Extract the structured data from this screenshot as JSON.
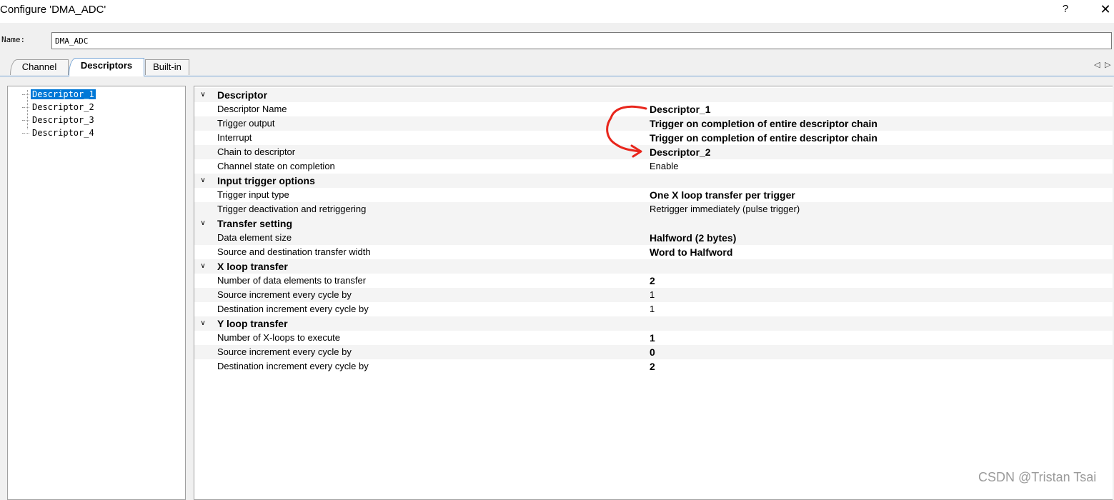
{
  "window": {
    "title": "Configure 'DMA_ADC'",
    "help_glyph": "?",
    "close_glyph": "✕"
  },
  "name_field": {
    "label": "Name:",
    "value": "DMA_ADC"
  },
  "tabs": [
    {
      "label": "Channel",
      "active": false
    },
    {
      "label": "Descriptors",
      "active": true
    },
    {
      "label": "Built-in",
      "active": false
    }
  ],
  "tab_scroll": {
    "left": "◁",
    "right": "▷"
  },
  "tree": {
    "items": [
      {
        "label": "Descriptor_1",
        "selected": true
      },
      {
        "label": "Descriptor_2",
        "selected": false
      },
      {
        "label": "Descriptor_3",
        "selected": false
      },
      {
        "label": "Descriptor_4",
        "selected": false
      }
    ]
  },
  "chevron_glyph": "∨",
  "properties": [
    {
      "type": "category",
      "label": "Descriptor"
    },
    {
      "type": "prop",
      "name": "Descriptor Name",
      "value": "Descriptor_1",
      "bold": true
    },
    {
      "type": "prop",
      "name": "Trigger output",
      "value": "Trigger on completion of entire descriptor chain",
      "bold": true
    },
    {
      "type": "prop",
      "name": "Interrupt",
      "value": "Trigger on completion of entire descriptor chain",
      "bold": true
    },
    {
      "type": "prop",
      "name": "Chain to descriptor",
      "value": "Descriptor_2",
      "bold": true
    },
    {
      "type": "prop",
      "name": "Channel state on completion",
      "value": "Enable",
      "bold": false
    },
    {
      "type": "category",
      "label": "Input trigger options"
    },
    {
      "type": "prop",
      "name": "Trigger input type",
      "value": "One X loop transfer per trigger",
      "bold": true
    },
    {
      "type": "prop",
      "name": "Trigger deactivation and retriggering",
      "value": "Retrigger immediately (pulse trigger)",
      "bold": false
    },
    {
      "type": "category",
      "label": "Transfer setting"
    },
    {
      "type": "prop",
      "name": "Data element size",
      "value": "Halfword (2 bytes)",
      "bold": true
    },
    {
      "type": "prop",
      "name": "Source and destination transfer width",
      "value": "Word to Halfword",
      "bold": true
    },
    {
      "type": "category",
      "label": "X loop transfer"
    },
    {
      "type": "prop",
      "name": "Number of data elements to transfer",
      "value": "2",
      "bold": true
    },
    {
      "type": "prop",
      "name": "Source increment every cycle by",
      "value": "1",
      "bold": false
    },
    {
      "type": "prop",
      "name": "Destination increment every cycle by",
      "value": "1",
      "bold": false
    },
    {
      "type": "category",
      "label": "Y loop transfer"
    },
    {
      "type": "prop",
      "name": "Number of X-loops to execute",
      "value": "1",
      "bold": true
    },
    {
      "type": "prop",
      "name": "Source increment every cycle by",
      "value": "0",
      "bold": true
    },
    {
      "type": "prop",
      "name": "Destination increment every cycle by",
      "value": "2",
      "bold": true
    }
  ],
  "watermark": "CSDN @Tristan Tsai",
  "colors": {
    "selection": "#0078d7",
    "annotation": "#e8261c",
    "tab_accent": "#7aa7d6"
  }
}
